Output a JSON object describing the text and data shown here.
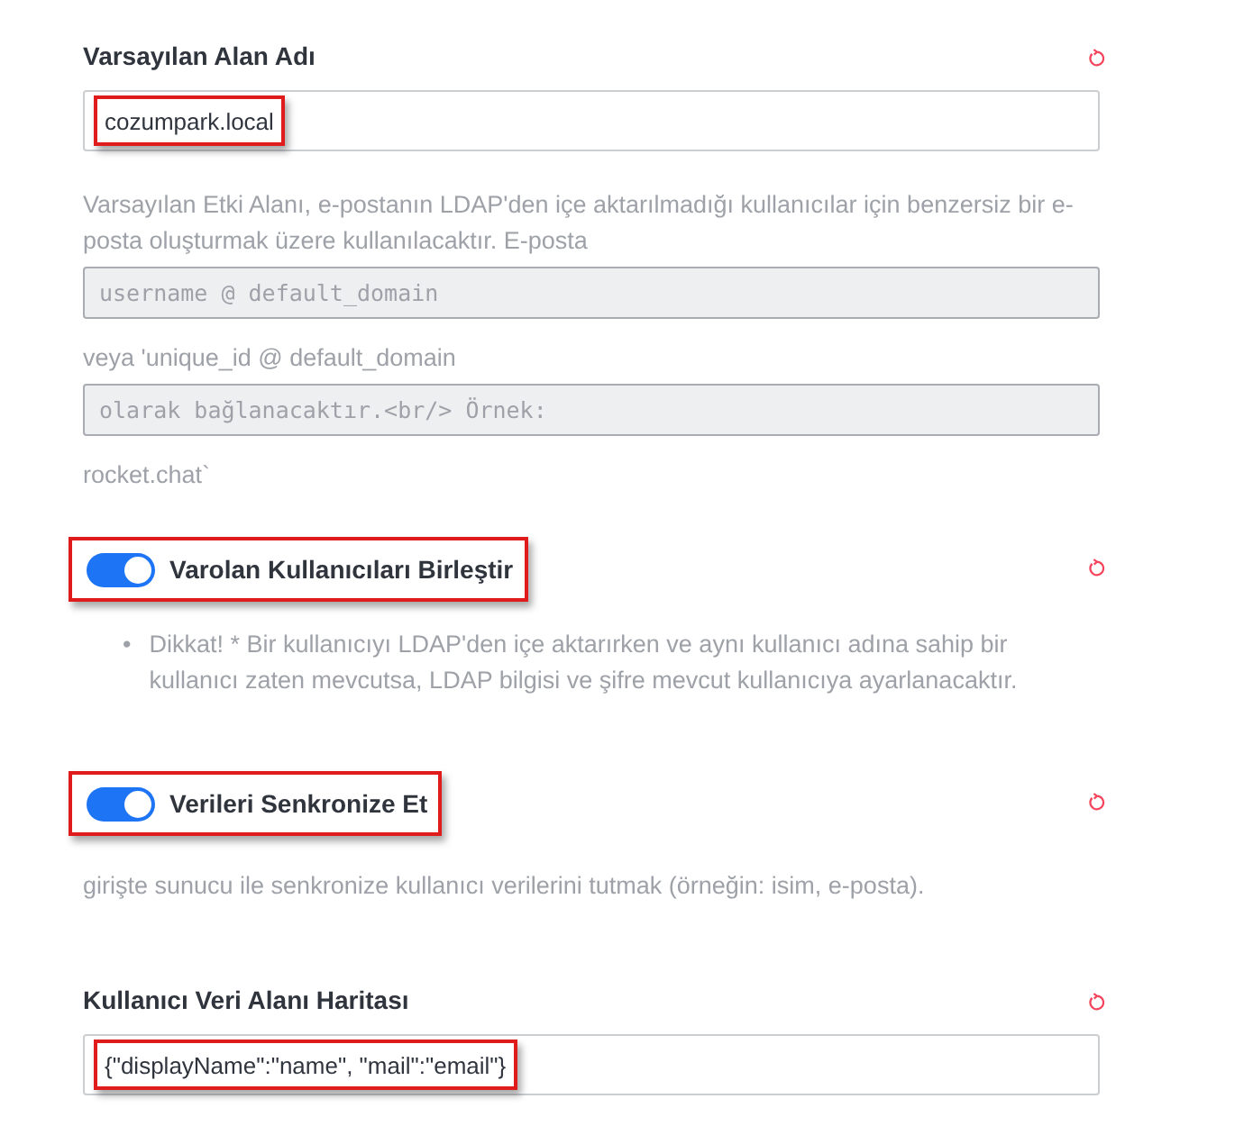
{
  "settings": [
    {
      "kind": "text",
      "label": "Varsayılan Alan Adı",
      "value": "cozumpark.local",
      "highlighted": true,
      "description": [
        {
          "kind": "text",
          "text": "Varsayılan Etki Alanı, e-postanın LDAP'den içe aktarılmadığı kullanıcılar için benzersiz bir e-posta oluşturmak üzere kullanılacaktır. E-posta"
        },
        {
          "kind": "code",
          "text": "username @ default_domain"
        },
        {
          "kind": "text",
          "text": "veya 'unique_id @ default_domain"
        },
        {
          "kind": "code",
          "text": "olarak bağlanacaktır.<br/> Örnek:"
        },
        {
          "kind": "text",
          "text": "rocket.chat`"
        }
      ]
    },
    {
      "kind": "toggle",
      "label": "Varolan Kullanıcıları Birleştir",
      "on": true,
      "highlighted": true,
      "description": [
        {
          "kind": "bullet",
          "marker": "•",
          "text": "Dikkat! * Bir kullanıcıyı LDAP'den içe aktarırken ve aynı kullanıcı adına sahip bir kullanıcı zaten mevcutsa, LDAP bilgisi ve şifre mevcut kullanıcıya ayarlanacaktır."
        }
      ]
    },
    {
      "kind": "toggle",
      "label": "Verileri Senkronize Et",
      "on": true,
      "highlighted": true,
      "description": [
        {
          "kind": "text",
          "text": "girişte sunucu ile senkronize kullanıcı verilerini tutmak (örneğin: isim, e-posta)."
        }
      ]
    },
    {
      "kind": "text",
      "label": "Kullanıcı Veri Alanı Haritası",
      "value": "{\"displayName\":\"name\", \"mail\":\"email\"}",
      "highlighted": true
    }
  ]
}
